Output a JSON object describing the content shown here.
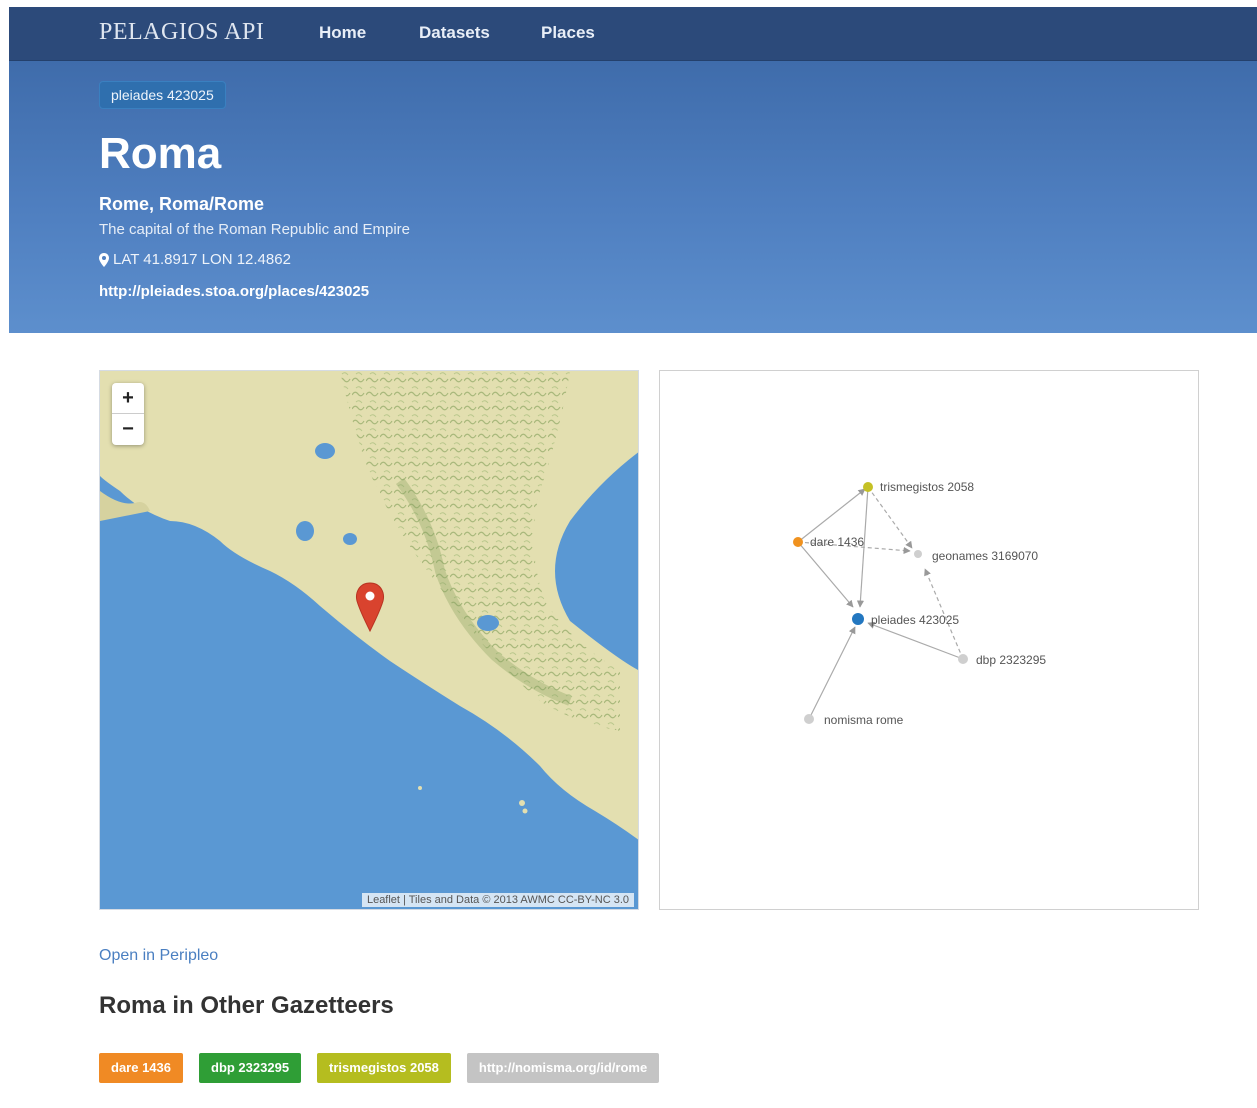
{
  "navbar": {
    "brand": "PELAGIOS API",
    "links": [
      "Home",
      "Datasets",
      "Places"
    ]
  },
  "hero": {
    "badge": "pleiades 423025",
    "title": "Roma",
    "names": "Rome, Roma/Rome",
    "description": "The capital of the Roman Republic and Empire",
    "coordinates": "LAT 41.8917 LON 12.4862",
    "uri": "http://pleiades.stoa.org/places/423025"
  },
  "map": {
    "zoom_in": "+",
    "zoom_out": "−",
    "attribution": "Leaflet | Tiles and Data © 2013 AWMC CC-BY-NC 3.0"
  },
  "graph": {
    "nodes": [
      {
        "label": "trismegistos 2058",
        "color": "#c5c125"
      },
      {
        "label": "dare 1436",
        "color": "#f0921f"
      },
      {
        "label": "geonames 3169070",
        "color": "#cfcfcf"
      },
      {
        "label": "pleiades 423025",
        "color": "#2377c0"
      },
      {
        "label": "dbp 2323295",
        "color": "#cfcfcf"
      },
      {
        "label": "nomisma rome",
        "color": "#cfcfcf"
      }
    ]
  },
  "open_link": "Open in Peripleo",
  "section_title": "Roma in Other Gazetteers",
  "gazetteer_tags": [
    {
      "label": "dare 1436",
      "color": "#f08a24"
    },
    {
      "label": "dbp 2323295",
      "color": "#2f9e36"
    },
    {
      "label": "trismegistos 2058",
      "color": "#b5bd1f"
    },
    {
      "label": "http://nomisma.org/id/rome",
      "color": "#c4c4c4"
    }
  ],
  "colors": {
    "navbar": "#2c4a7a",
    "hero_top": "#3f6cab",
    "hero_bottom": "#5d8fcd",
    "marker": "#e0533e"
  }
}
